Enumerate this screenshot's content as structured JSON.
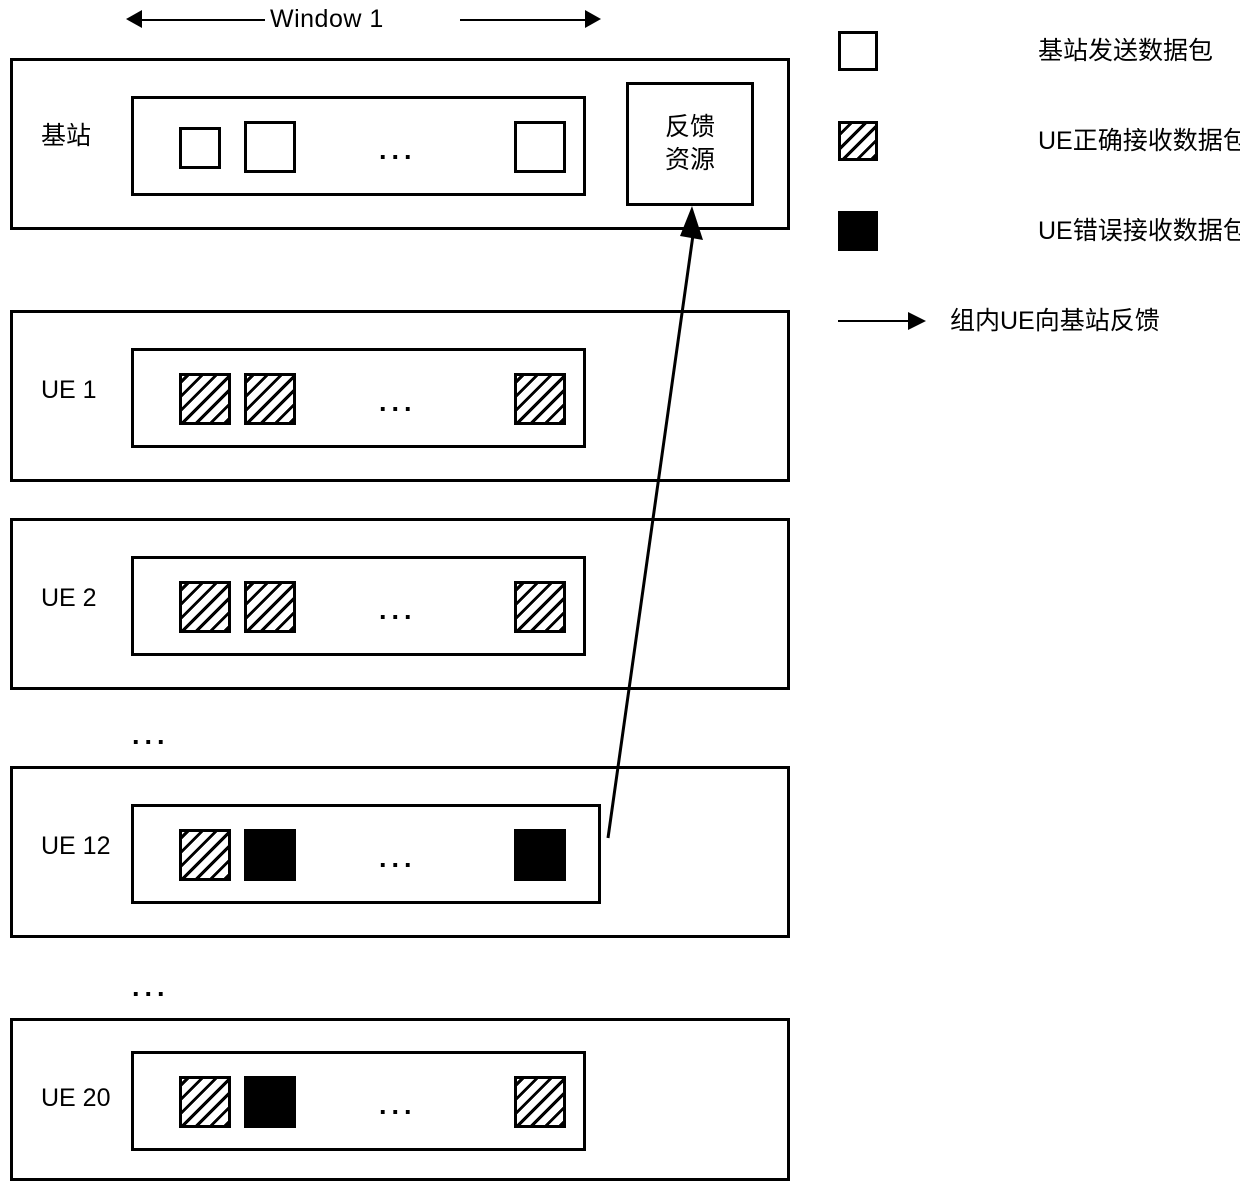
{
  "diagram": {
    "window_label": "Window 1",
    "feedback_box": {
      "line1": "反馈",
      "line2": "资源"
    },
    "gap_ellipsis": "...",
    "rows": [
      {
        "label": "基站",
        "ellipsis": "...",
        "cells": [
          "empty",
          "empty",
          "empty"
        ]
      },
      {
        "label": "UE 1",
        "ellipsis": "...",
        "cells": [
          "hatch",
          "hatch",
          "hatch"
        ]
      },
      {
        "label": "UE 2",
        "ellipsis": "...",
        "cells": [
          "hatch",
          "hatch",
          "hatch"
        ]
      },
      {
        "label": "UE 12",
        "ellipsis": "...",
        "cells": [
          "hatch",
          "solid",
          "solid"
        ]
      },
      {
        "label": "UE 20",
        "ellipsis": "...",
        "cells": [
          "hatch",
          "solid",
          "hatch"
        ]
      }
    ]
  },
  "legend": {
    "items": [
      {
        "swatch": "empty-square-icon",
        "text": "基站发送数据包"
      },
      {
        "swatch": "hatched-square-icon",
        "text": "UE正确接收数据包"
      },
      {
        "swatch": "filled-square-icon",
        "text": "UE错误接收数据包"
      },
      {
        "swatch": "arrow-icon",
        "text": "组内UE向基站反馈"
      }
    ]
  }
}
